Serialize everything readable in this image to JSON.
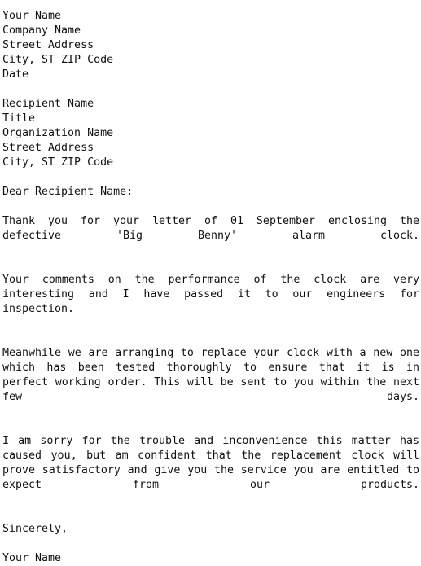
{
  "document": {
    "type": "plain-text-letter",
    "colors": {
      "background": "#ffffff",
      "text": "#111111"
    },
    "sender_block": [
      "Your Name",
      "Company Name",
      "Street Address",
      "City, ST ZIP Code",
      "Date"
    ],
    "recipient_block": [
      "Recipient Name",
      "Title",
      "Organization Name",
      "Street Address",
      "City, ST ZIP Code"
    ],
    "salutation": "Dear Recipient Name:",
    "body_paragraphs": [
      "Thank you for your letter of 01 September enclosing the defective 'Big Benny' alarm clock.",
      "Your comments on the performance of the clock are very interesting and I have passed it to our engineers for inspection.",
      "Meanwhile we are arranging to replace your clock with a new one which has been tested thoroughly to ensure that it is in perfect working order. This will be sent to you within the next few days.",
      "I am sorry for the trouble and inconvenience this matter has caused you, but am confident that the replacement clock will prove satisfactory and give you the service you are entitled to expect from our products."
    ],
    "closing": "Sincerely,",
    "signature_name": "Your Name"
  }
}
